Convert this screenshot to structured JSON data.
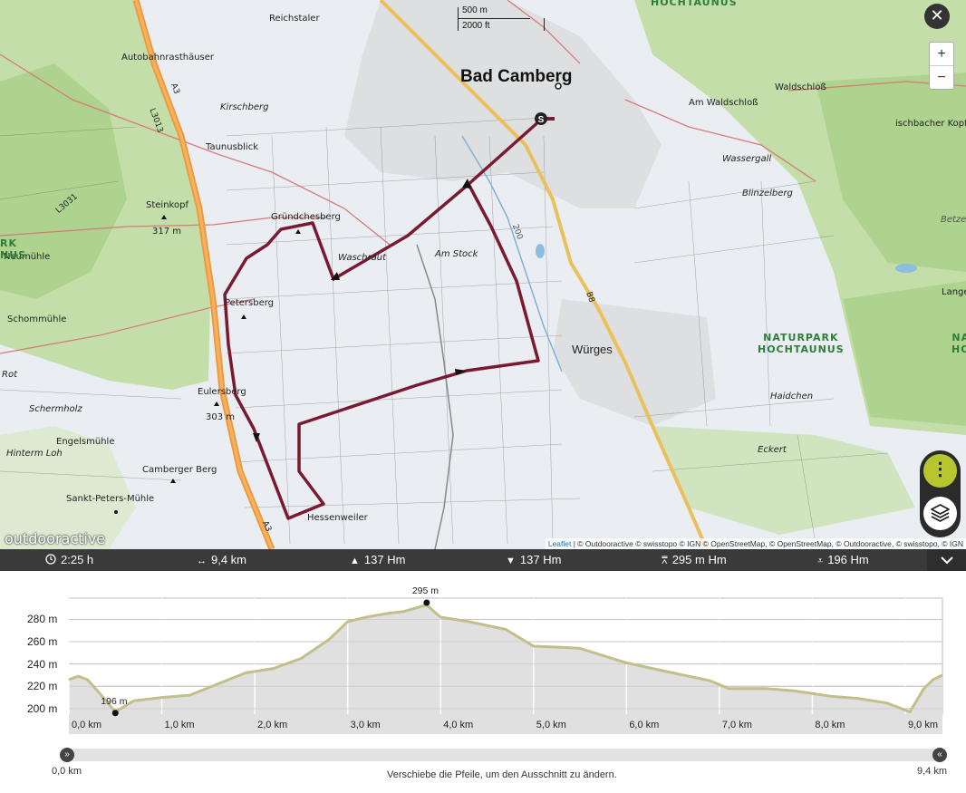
{
  "map": {
    "scale": {
      "metric": "500 m",
      "imperial": "2000 ft"
    },
    "controls": {
      "close": "✕",
      "zoom_in": "+",
      "zoom_out": "−",
      "more": "⋮"
    },
    "logo": "outdooractive",
    "attribution": {
      "leaflet": "Leaflet",
      "rest": " | © Outdooractive © swisstopo © IGN © OpenStreetMap, © OpenStreetMap, © Outdooractive, © swisstopo, © IGN"
    },
    "labels": {
      "bad_camberg": "Bad Camberg",
      "wuerges": "Würges",
      "reichstaler": "Reichstaler",
      "autobahnrasthaeuser": "Autobahnrasthäuser",
      "kirschberg": "Kirschberg",
      "taunusblick": "Taunusblick",
      "steinkopf": "Steinkopf",
      "steinkopf_ele": "317 m",
      "gruendchesberg": "Gründchesberg",
      "neumuehle": "Neumühle",
      "schommuehle": "Schommühle",
      "rot": "Rot",
      "petersberg": "Petersberg",
      "waschraut": "Waschraut",
      "am_stock": "Am Stock",
      "eulersberg": "Eulersberg",
      "eulersberg_ele": "303 m",
      "schermholz": "Schermholz",
      "engelsmuehle": "Engelsmühle",
      "hinterm_loh": "Hinterm Loh",
      "camberger_berg": "Camberger Berg",
      "sankt_peters_muehle": "Sankt-Peters-Mühle",
      "hessenweiler": "Hessenweiler",
      "am_waldschloss": "Am Waldschloß",
      "waldschloss": "Waldschloß",
      "ischbacher_kopf": "ischbacher Kopf",
      "wassergall": "Wassergall",
      "blinzelberg": "Blinzelberg",
      "betze": "Betze",
      "langeb": "Langeb",
      "naturpark": "NATURPARK",
      "hochtaunus": "HOCHTAUNUS",
      "hochtaunus_top": "HOCHTAUNUS",
      "haidchen": "Haidchen",
      "eckert": "Eckert",
      "na": "NA",
      "ho": "HO",
      "rk": "RK",
      "nus": "NUS",
      "road_l3013": "L3013",
      "road_l3031": "L3031",
      "road_a3_top": "A3",
      "road_a3_bottom": "A3",
      "road_b8": "B8",
      "road_200": "200"
    }
  },
  "stats": {
    "duration": "2:25 h",
    "distance": "9,4 km",
    "ascent": "137 Hm",
    "descent": "137 Hm",
    "highest": "295 m Hm",
    "lowest": "196 Hm"
  },
  "chart_data": {
    "type": "area",
    "xlabel": "",
    "ylabel": "",
    "xlim": [
      0,
      9.4
    ],
    "ylim": [
      195,
      295
    ],
    "y_ticks": [
      "200 m",
      "220 m",
      "240 m",
      "260 m",
      "280 m"
    ],
    "y_tick_values": [
      200,
      220,
      240,
      260,
      280
    ],
    "x_ticks": [
      "0,0 km",
      "1,0 km",
      "2,0 km",
      "3,0 km",
      "4,0 km",
      "5,0 km",
      "6,0 km",
      "7,0 km",
      "8,0 km",
      "9,0 km"
    ],
    "x_tick_values": [
      0,
      1,
      2,
      3,
      4,
      5,
      6,
      7,
      8,
      9
    ],
    "series": [
      {
        "x": [
          0,
          0.1,
          0.2,
          0.35,
          0.5,
          0.7,
          1.0,
          1.3,
          1.6,
          1.9,
          2.2,
          2.5,
          2.8,
          3.0,
          3.2,
          3.4,
          3.6,
          3.85,
          4.0,
          4.3,
          4.7,
          5.0,
          5.3,
          5.5,
          6.0,
          6.5,
          6.9,
          7.1,
          7.5,
          7.8,
          8.2,
          8.5,
          8.8,
          9.05,
          9.2,
          9.3,
          9.4
        ],
        "y": [
          226,
          229,
          226,
          212,
          197,
          207,
          210,
          212,
          222,
          232,
          236,
          245,
          262,
          278,
          282,
          285,
          287,
          293,
          282,
          278,
          271,
          256,
          255,
          254,
          241,
          232,
          225,
          218,
          218,
          216,
          211,
          209,
          205,
          197,
          218,
          226,
          230
        ]
      }
    ],
    "annotations": [
      {
        "label": "295 m",
        "x": 3.85,
        "y": 295
      },
      {
        "label": "196 m",
        "x": 0.5,
        "y": 196
      }
    ]
  },
  "slider": {
    "start_label": "0,0 km",
    "end_label": "9,4 km",
    "hint": "Verschiebe die Pfeile, um den Ausschnitt zu ändern."
  }
}
